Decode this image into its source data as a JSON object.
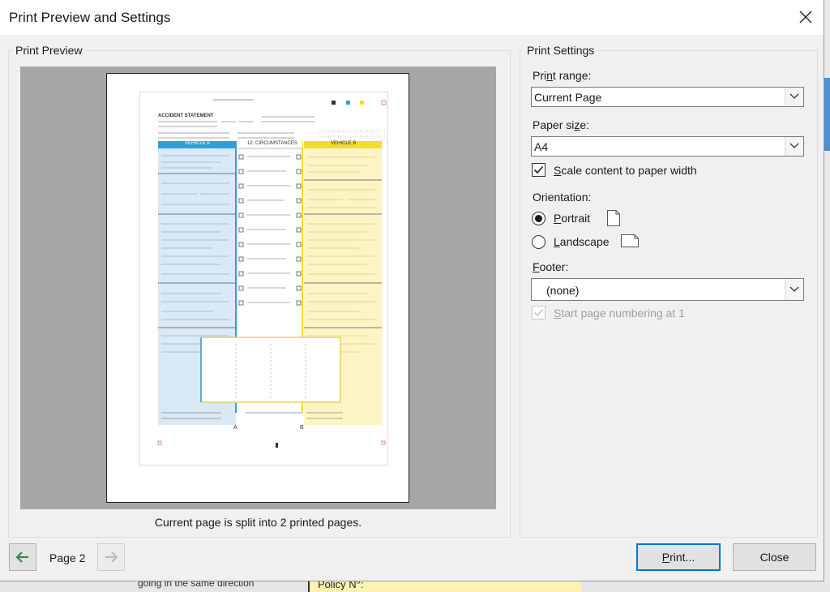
{
  "window": {
    "title": "Print Preview and Settings",
    "close_icon": "close-icon"
  },
  "preview": {
    "legend": "Print Preview",
    "caption": "Current page is split into 2 printed pages.",
    "page_label": "Page 2",
    "document": {
      "heading": "ACCIDENT STATEMENT",
      "vehicle_a": "VEHICLE A",
      "circumstances": "12. CIRCUMSTANCES",
      "vehicle_b": "VEHICLE B",
      "corner_a": "A",
      "corner_b": "B"
    }
  },
  "settings": {
    "legend": "Print Settings",
    "print_range": {
      "label_pre": "Pri",
      "label_accel": "n",
      "label_post": "t range:",
      "value": "Current Page"
    },
    "paper_size": {
      "label_pre": "Paper si",
      "label_accel": "z",
      "label_post": "e:",
      "value": "A4"
    },
    "scale": {
      "label_pre": "",
      "label_accel": "S",
      "label_post": "cale content to paper width",
      "checked": true
    },
    "orientation": {
      "label": "Orientation:",
      "portrait": {
        "label_pre": "",
        "label_accel": "P",
        "label_post": "ortrait",
        "selected": true,
        "icon": "portrait-page-icon"
      },
      "landscape": {
        "label_pre": "",
        "label_accel": "L",
        "label_post": "andscape",
        "selected": false,
        "icon": "landscape-page-icon"
      }
    },
    "footer": {
      "label_pre": "",
      "label_accel": "F",
      "label_post": "ooter:",
      "value": "(none)"
    },
    "start_numbering": {
      "label_pre": "",
      "label_accel": "S",
      "label_post": "tart page numbering at 1",
      "checked": true,
      "disabled": true
    }
  },
  "buttons": {
    "print": {
      "label_pre": "",
      "label_accel": "P",
      "label_post": "rint..."
    },
    "close": "Close"
  },
  "background": {
    "text_left": "going in the same direction",
    "text_right": "Policy N°:"
  },
  "colors": {
    "vehicle_a": "#2f9fd9",
    "vehicle_a_fill": "#d9e9f6",
    "vehicle_b": "#f2dc32",
    "vehicle_b_fill": "#fdf4c4",
    "accent": "#0078d7",
    "enabled_arrow": "#2e8b57",
    "disabled_arrow": "#bcbcbc"
  }
}
